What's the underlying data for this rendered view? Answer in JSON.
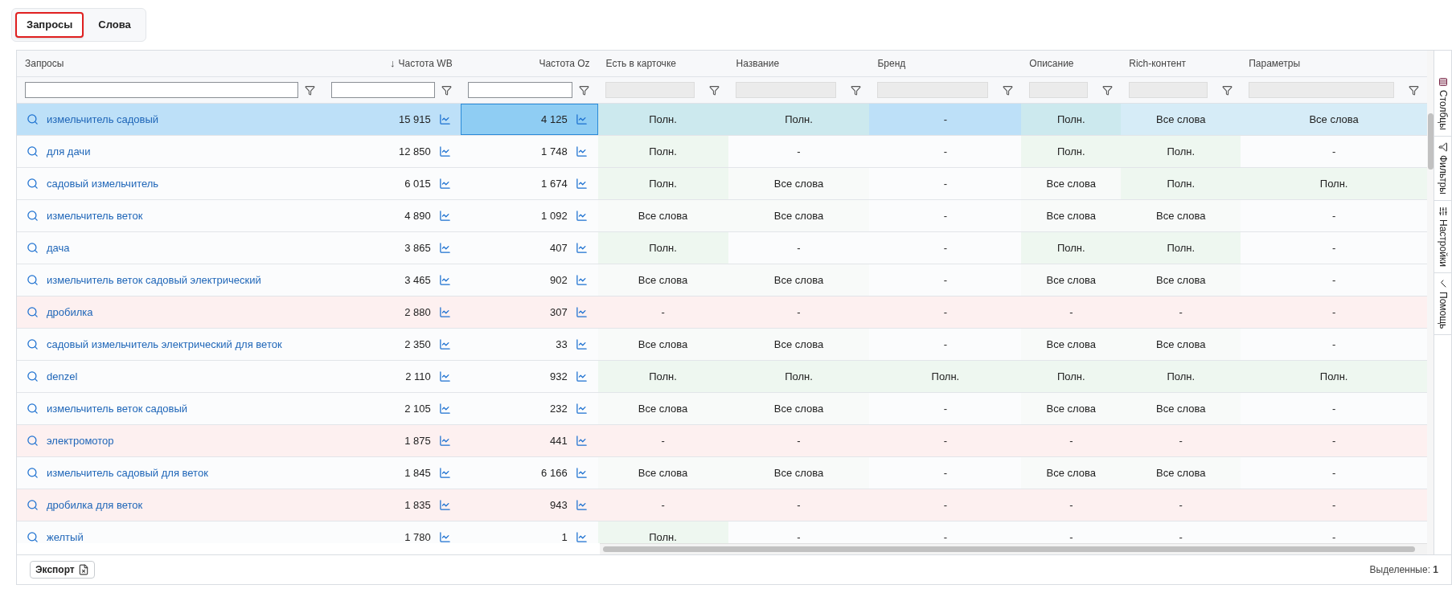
{
  "tabs": [
    {
      "label": "Запросы",
      "selected": true
    },
    {
      "label": "Слова",
      "selected": false
    }
  ],
  "columns": [
    {
      "label": "Запросы",
      "filter_disabled": false
    },
    {
      "label": "Частота WB",
      "sort_arrow": "↓",
      "filter_disabled": false
    },
    {
      "label": "Частота Oz",
      "filter_disabled": false
    },
    {
      "label": "Есть в карточке",
      "filter_disabled": true
    },
    {
      "label": "Название",
      "filter_disabled": true
    },
    {
      "label": "Бренд",
      "filter_disabled": true
    },
    {
      "label": "Описание",
      "filter_disabled": true
    },
    {
      "label": "Rich-контент",
      "filter_disabled": true
    },
    {
      "label": "Параметры",
      "filter_disabled": true
    }
  ],
  "rows": [
    {
      "query": "измельчитель садовый",
      "wb": "15 915",
      "oz": "4 125",
      "selected": true,
      "oz_focused": true,
      "no_match": false,
      "cells": [
        {
          "text": "Полн.",
          "kind": "full"
        },
        {
          "text": "Полн.",
          "kind": "full"
        },
        {
          "text": "-",
          "kind": "none"
        },
        {
          "text": "Полн.",
          "kind": "full"
        },
        {
          "text": "Все слова",
          "kind": "words"
        },
        {
          "text": "Все слова",
          "kind": "words"
        }
      ]
    },
    {
      "query": "для дачи",
      "wb": "12 850",
      "oz": "1 748",
      "selected": false,
      "oz_focused": false,
      "no_match": false,
      "cells": [
        {
          "text": "Полн.",
          "kind": "full"
        },
        {
          "text": "-",
          "kind": "none"
        },
        {
          "text": "-",
          "kind": "none"
        },
        {
          "text": "Полн.",
          "kind": "full"
        },
        {
          "text": "Полн.",
          "kind": "full"
        },
        {
          "text": "-",
          "kind": "none"
        }
      ]
    },
    {
      "query": "садовый измельчитель",
      "wb": "6 015",
      "oz": "1 674",
      "selected": false,
      "oz_focused": false,
      "no_match": false,
      "cells": [
        {
          "text": "Полн.",
          "kind": "full"
        },
        {
          "text": "Все слова",
          "kind": "words"
        },
        {
          "text": "-",
          "kind": "none"
        },
        {
          "text": "Все слова",
          "kind": "words"
        },
        {
          "text": "Полн.",
          "kind": "full"
        },
        {
          "text": "Полн.",
          "kind": "full"
        }
      ]
    },
    {
      "query": "измельчитель веток",
      "wb": "4 890",
      "oz": "1 092",
      "selected": false,
      "oz_focused": false,
      "no_match": false,
      "cells": [
        {
          "text": "Все слова",
          "kind": "words"
        },
        {
          "text": "Все слова",
          "kind": "words"
        },
        {
          "text": "-",
          "kind": "none"
        },
        {
          "text": "Все слова",
          "kind": "words"
        },
        {
          "text": "Все слова",
          "kind": "words"
        },
        {
          "text": "-",
          "kind": "none"
        }
      ]
    },
    {
      "query": "дача",
      "wb": "3 865",
      "oz": "407",
      "selected": false,
      "oz_focused": false,
      "no_match": false,
      "cells": [
        {
          "text": "Полн.",
          "kind": "full"
        },
        {
          "text": "-",
          "kind": "none"
        },
        {
          "text": "-",
          "kind": "none"
        },
        {
          "text": "Полн.",
          "kind": "full"
        },
        {
          "text": "Полн.",
          "kind": "full"
        },
        {
          "text": "-",
          "kind": "none"
        }
      ]
    },
    {
      "query": "измельчитель веток садовый электрический",
      "wb": "3 465",
      "oz": "902",
      "selected": false,
      "oz_focused": false,
      "no_match": false,
      "cells": [
        {
          "text": "Все слова",
          "kind": "words"
        },
        {
          "text": "Все слова",
          "kind": "words"
        },
        {
          "text": "-",
          "kind": "none"
        },
        {
          "text": "Все слова",
          "kind": "words"
        },
        {
          "text": "Все слова",
          "kind": "words"
        },
        {
          "text": "-",
          "kind": "none"
        }
      ]
    },
    {
      "query": "дробилка",
      "wb": "2 880",
      "oz": "307",
      "selected": false,
      "oz_focused": false,
      "no_match": true,
      "cells": [
        {
          "text": "-",
          "kind": "none"
        },
        {
          "text": "-",
          "kind": "none"
        },
        {
          "text": "-",
          "kind": "none"
        },
        {
          "text": "-",
          "kind": "none"
        },
        {
          "text": "-",
          "kind": "none"
        },
        {
          "text": "-",
          "kind": "none"
        }
      ]
    },
    {
      "query": "садовый измельчитель электрический для веток",
      "wb": "2 350",
      "oz": "33",
      "selected": false,
      "oz_focused": false,
      "no_match": false,
      "cells": [
        {
          "text": "Все слова",
          "kind": "words"
        },
        {
          "text": "Все слова",
          "kind": "words"
        },
        {
          "text": "-",
          "kind": "none"
        },
        {
          "text": "Все слова",
          "kind": "words"
        },
        {
          "text": "Все слова",
          "kind": "words"
        },
        {
          "text": "-",
          "kind": "none"
        }
      ]
    },
    {
      "query": "denzel",
      "wb": "2 110",
      "oz": "932",
      "selected": false,
      "oz_focused": false,
      "no_match": false,
      "cells": [
        {
          "text": "Полн.",
          "kind": "full"
        },
        {
          "text": "Полн.",
          "kind": "full"
        },
        {
          "text": "Полн.",
          "kind": "full"
        },
        {
          "text": "Полн.",
          "kind": "full"
        },
        {
          "text": "Полн.",
          "kind": "full"
        },
        {
          "text": "Полн.",
          "kind": "full"
        }
      ]
    },
    {
      "query": "измельчитель веток садовый",
      "wb": "2 105",
      "oz": "232",
      "selected": false,
      "oz_focused": false,
      "no_match": false,
      "cells": [
        {
          "text": "Все слова",
          "kind": "words"
        },
        {
          "text": "Все слова",
          "kind": "words"
        },
        {
          "text": "-",
          "kind": "none"
        },
        {
          "text": "Все слова",
          "kind": "words"
        },
        {
          "text": "Все слова",
          "kind": "words"
        },
        {
          "text": "-",
          "kind": "none"
        }
      ]
    },
    {
      "query": "электромотор",
      "wb": "1 875",
      "oz": "441",
      "selected": false,
      "oz_focused": false,
      "no_match": true,
      "cells": [
        {
          "text": "-",
          "kind": "none"
        },
        {
          "text": "-",
          "kind": "none"
        },
        {
          "text": "-",
          "kind": "none"
        },
        {
          "text": "-",
          "kind": "none"
        },
        {
          "text": "-",
          "kind": "none"
        },
        {
          "text": "-",
          "kind": "none"
        }
      ]
    },
    {
      "query": "измельчитель садовый для веток",
      "wb": "1 845",
      "oz": "6 166",
      "selected": false,
      "oz_focused": false,
      "no_match": false,
      "cells": [
        {
          "text": "Все слова",
          "kind": "words"
        },
        {
          "text": "Все слова",
          "kind": "words"
        },
        {
          "text": "-",
          "kind": "none"
        },
        {
          "text": "Все слова",
          "kind": "words"
        },
        {
          "text": "Все слова",
          "kind": "words"
        },
        {
          "text": "-",
          "kind": "none"
        }
      ]
    },
    {
      "query": "дробилка для веток",
      "wb": "1 835",
      "oz": "943",
      "selected": false,
      "oz_focused": false,
      "no_match": true,
      "cells": [
        {
          "text": "-",
          "kind": "none"
        },
        {
          "text": "-",
          "kind": "none"
        },
        {
          "text": "-",
          "kind": "none"
        },
        {
          "text": "-",
          "kind": "none"
        },
        {
          "text": "-",
          "kind": "none"
        },
        {
          "text": "-",
          "kind": "none"
        }
      ]
    },
    {
      "query": "желтый",
      "wb": "1 780",
      "oz": "1",
      "selected": false,
      "oz_focused": false,
      "no_match": false,
      "cells": [
        {
          "text": "Полн.",
          "kind": "full"
        },
        {
          "text": "-",
          "kind": "none"
        },
        {
          "text": "-",
          "kind": "none"
        },
        {
          "text": "-",
          "kind": "none"
        },
        {
          "text": "-",
          "kind": "none"
        },
        {
          "text": "-",
          "kind": "none"
        }
      ]
    }
  ],
  "side_tabs": [
    {
      "label": "Столбцы",
      "kind": "columns"
    },
    {
      "label": "Фильтры",
      "kind": "filters"
    },
    {
      "label": "Настройки",
      "kind": "settings"
    },
    {
      "label": "Помощь",
      "kind": "help"
    }
  ],
  "footer": {
    "export_button": "Экспорт",
    "selected_count": "Выделенные: **1**"
  }
}
